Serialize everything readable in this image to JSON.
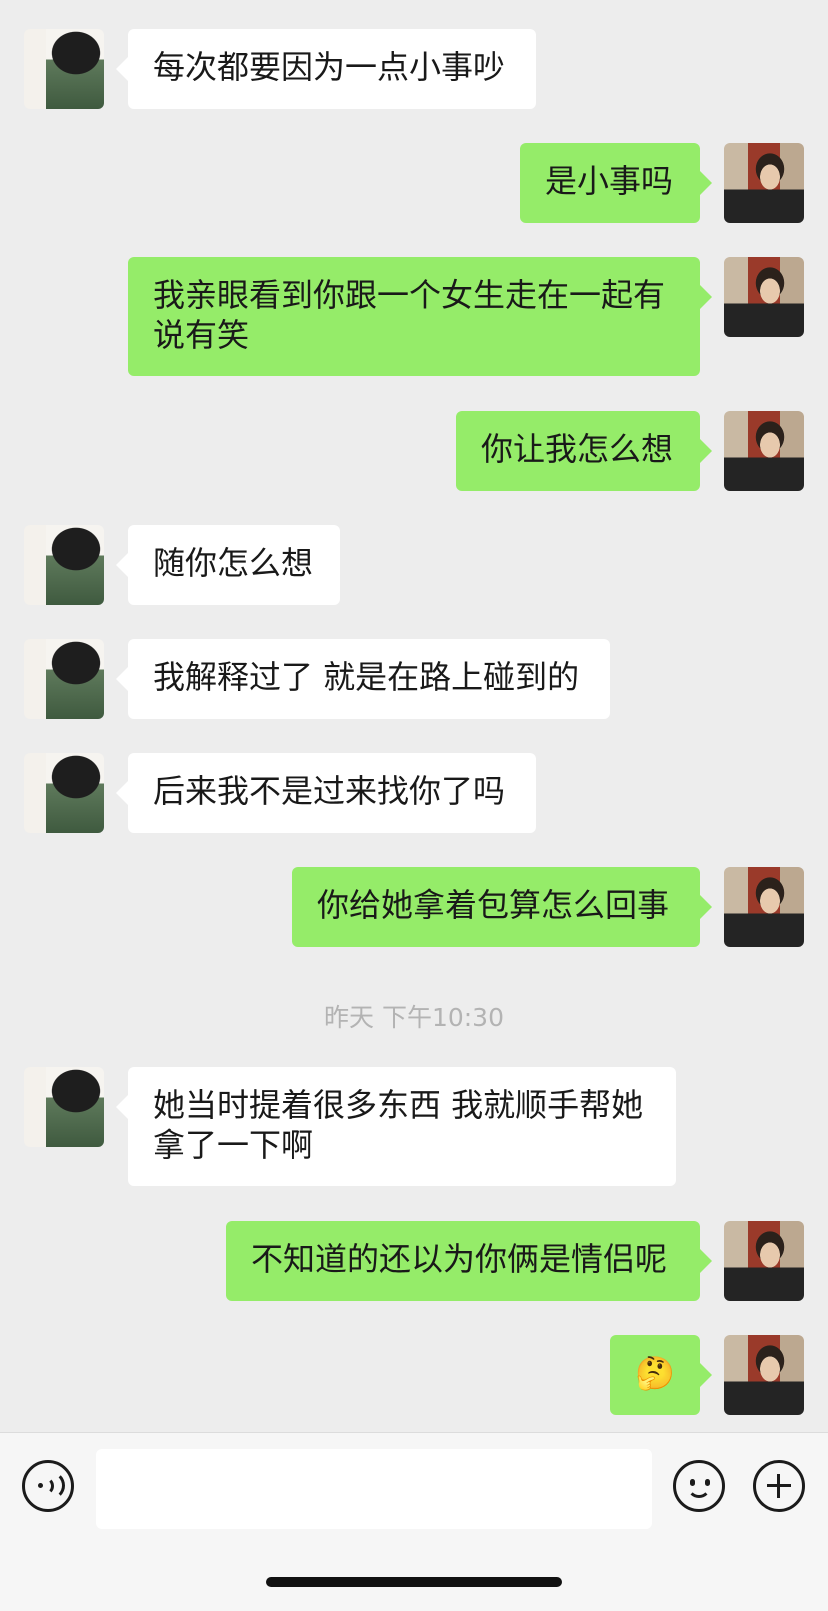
{
  "messages": [
    {
      "side": "in",
      "text": "每次都要因为一点小事吵"
    },
    {
      "side": "out",
      "text": "是小事吗"
    },
    {
      "side": "out",
      "text": "我亲眼看到你跟一个女生走在一起有说有笑"
    },
    {
      "side": "out",
      "text": "你让我怎么想"
    },
    {
      "side": "in",
      "text": "随你怎么想"
    },
    {
      "side": "in",
      "text": "我解释过了 就是在路上碰到的"
    },
    {
      "side": "in",
      "text": "后来我不是过来找你了吗"
    },
    {
      "side": "out",
      "text": "你给她拿着包算怎么回事"
    },
    {
      "side": "in",
      "text": "她当时提着很多东西 我就顺手帮她拿了一下啊"
    },
    {
      "side": "out",
      "text": "不知道的还以为你俩是情侣呢"
    },
    {
      "side": "out",
      "text": "🤔"
    }
  ],
  "timestamp": "昨天 下午10:30",
  "input_bar": {
    "voice_icon": "voice-icon",
    "emoji_icon": "emoji-icon",
    "plus_icon": "plus-icon",
    "input_value": ""
  },
  "colors": {
    "background": "#ededed",
    "incoming_bubble": "#ffffff",
    "outgoing_bubble": "#95ec69",
    "timestamp_text": "#b3b3b3"
  }
}
